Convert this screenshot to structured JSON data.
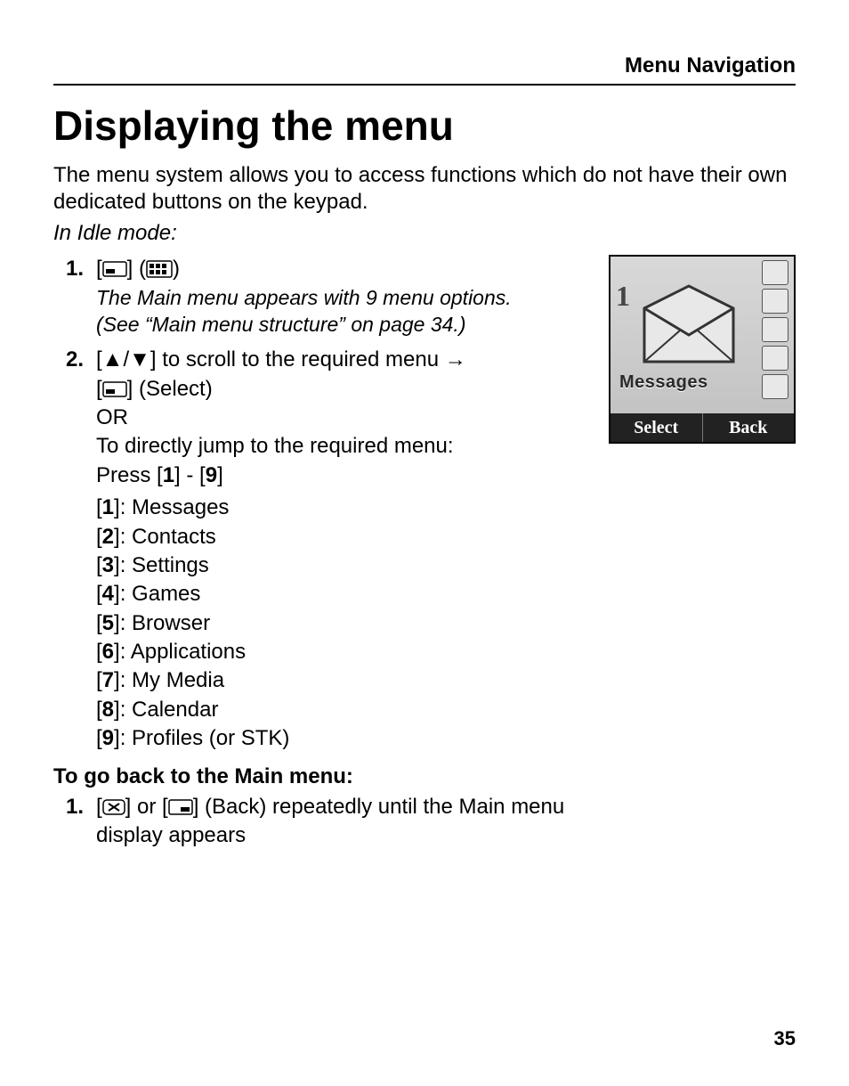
{
  "running_head": "Menu Navigation",
  "title": "Displaying the menu",
  "intro": "The menu system allows you to access functions which do not have their own dedicated buttons on the keypad.",
  "idle_label": "In Idle mode:",
  "step1": {
    "num": "1.",
    "note_line1": "The Main menu appears with 9 menu options.",
    "note_line2": "(See “Main menu structure” on page 34.)"
  },
  "step2": {
    "num": "2.",
    "scroll_text_before": "] to scroll to the required menu ",
    "select_label": "] (Select)",
    "or_label": "OR",
    "jump_text": "To directly jump to the required menu:",
    "press_prefix": "Press [",
    "press_range_dash": "] - [",
    "press_suffix": "]",
    "items": [
      {
        "key": "1",
        "label": "Messages"
      },
      {
        "key": "2",
        "label": "Contacts"
      },
      {
        "key": "3",
        "label": "Settings"
      },
      {
        "key": "4",
        "label": "Games"
      },
      {
        "key": "5",
        "label": "Browser"
      },
      {
        "key": "6",
        "label": "Applications"
      },
      {
        "key": "7",
        "label": "My Media"
      },
      {
        "key": "8",
        "label": "Calendar"
      },
      {
        "key": "9",
        "label": "Profiles (or STK)"
      }
    ]
  },
  "back_heading": "To go back to the Main menu:",
  "back_step": {
    "num": "1.",
    "text_after": "] (Back) repeatedly until the Main menu display appears",
    "or_word": "] or ["
  },
  "phone": {
    "one_badge": "1",
    "label": "Messages",
    "soft_left": "Select",
    "soft_right": "Back"
  },
  "page_number": "35"
}
